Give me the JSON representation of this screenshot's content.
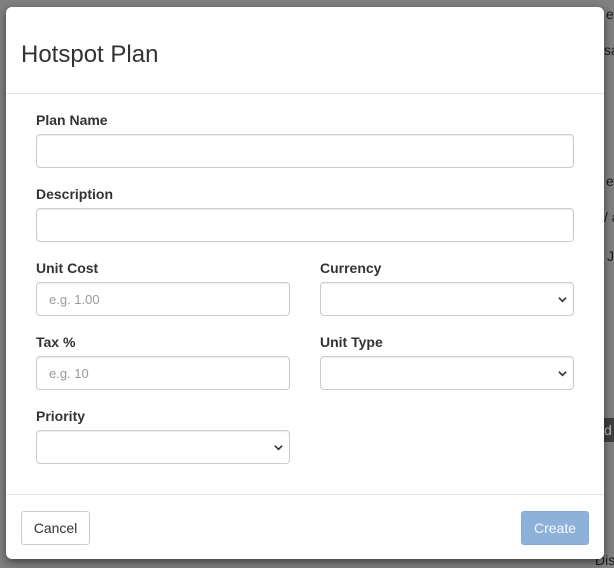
{
  "modal": {
    "title": "Hotspot Plan"
  },
  "form": {
    "plan_name": {
      "label": "Plan Name",
      "value": "",
      "placeholder": ""
    },
    "description": {
      "label": "Description",
      "value": "",
      "placeholder": ""
    },
    "unit_cost": {
      "label": "Unit Cost",
      "value": "",
      "placeholder": "e.g. 1.00"
    },
    "currency": {
      "label": "Currency",
      "selected": ""
    },
    "tax": {
      "label": "Tax %",
      "value": "",
      "placeholder": "e.g. 10"
    },
    "unit_type": {
      "label": "Unit Type",
      "selected": ""
    },
    "priority": {
      "label": "Priority",
      "selected": ""
    }
  },
  "footer": {
    "cancel_label": "Cancel",
    "create_label": "Create"
  },
  "background": {
    "fragments": [
      "e",
      "sa",
      "e",
      "/ a",
      "J",
      "d",
      "Dis"
    ]
  },
  "colors": {
    "primary_button": "#8db1d8",
    "overlay": "#808080"
  }
}
